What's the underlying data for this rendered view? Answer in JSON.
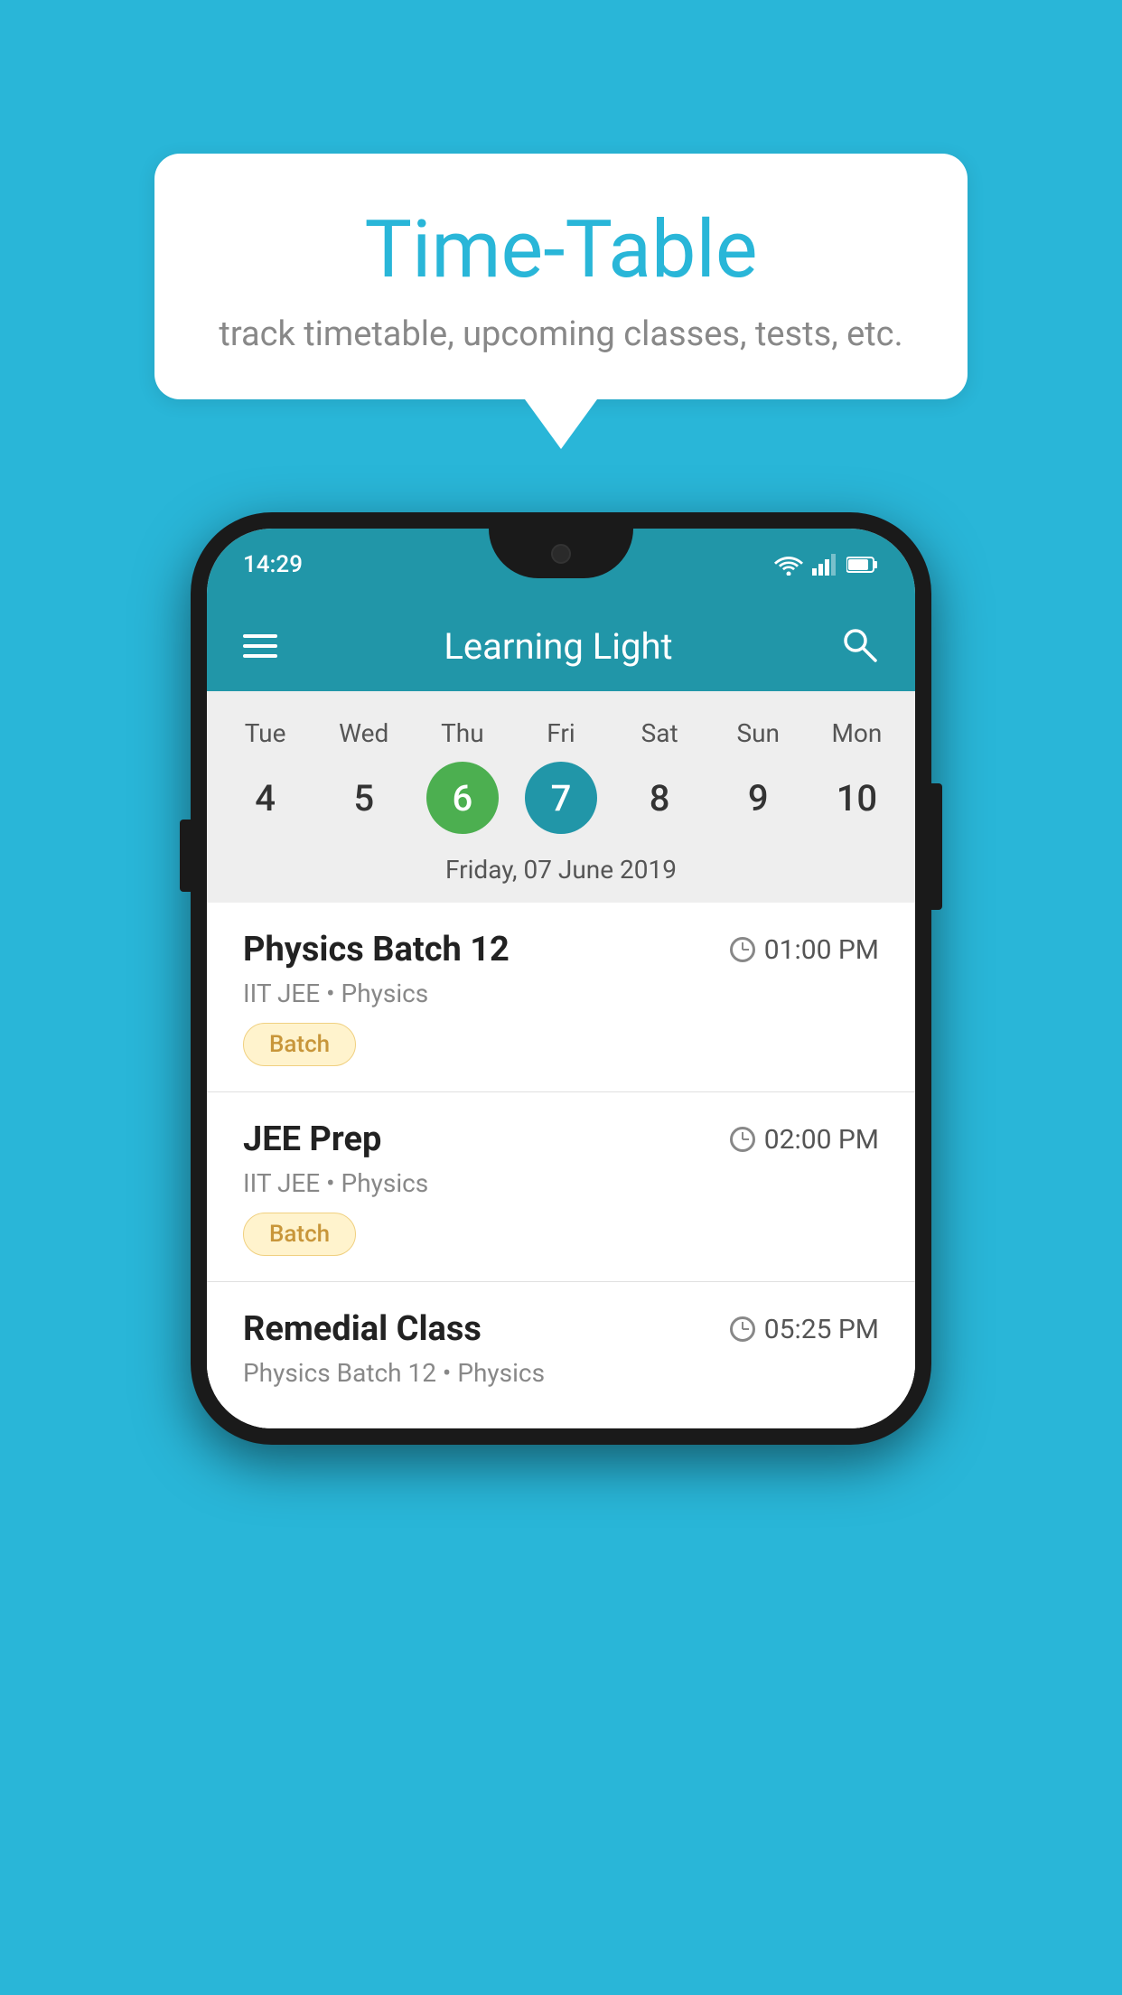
{
  "background_color": "#29b6d8",
  "speech_bubble": {
    "title": "Time-Table",
    "subtitle": "track timetable, upcoming classes, tests, etc."
  },
  "phone": {
    "status_bar": {
      "time": "14:29"
    },
    "app_bar": {
      "title": "Learning Light"
    },
    "calendar": {
      "days": [
        "Tue",
        "Wed",
        "Thu",
        "Fri",
        "Sat",
        "Sun",
        "Mon"
      ],
      "dates": [
        "4",
        "5",
        "6",
        "7",
        "8",
        "9",
        "10"
      ],
      "today_index": 2,
      "selected_index": 3,
      "selected_date_label": "Friday, 07 June 2019"
    },
    "schedule": [
      {
        "title": "Physics Batch 12",
        "time": "01:00 PM",
        "sub": "IIT JEE • Physics",
        "badge": "Batch"
      },
      {
        "title": "JEE Prep",
        "time": "02:00 PM",
        "sub": "IIT JEE • Physics",
        "badge": "Batch"
      },
      {
        "title": "Remedial Class",
        "time": "05:25 PM",
        "sub": "Physics Batch 12 • Physics",
        "badge": null
      }
    ]
  }
}
